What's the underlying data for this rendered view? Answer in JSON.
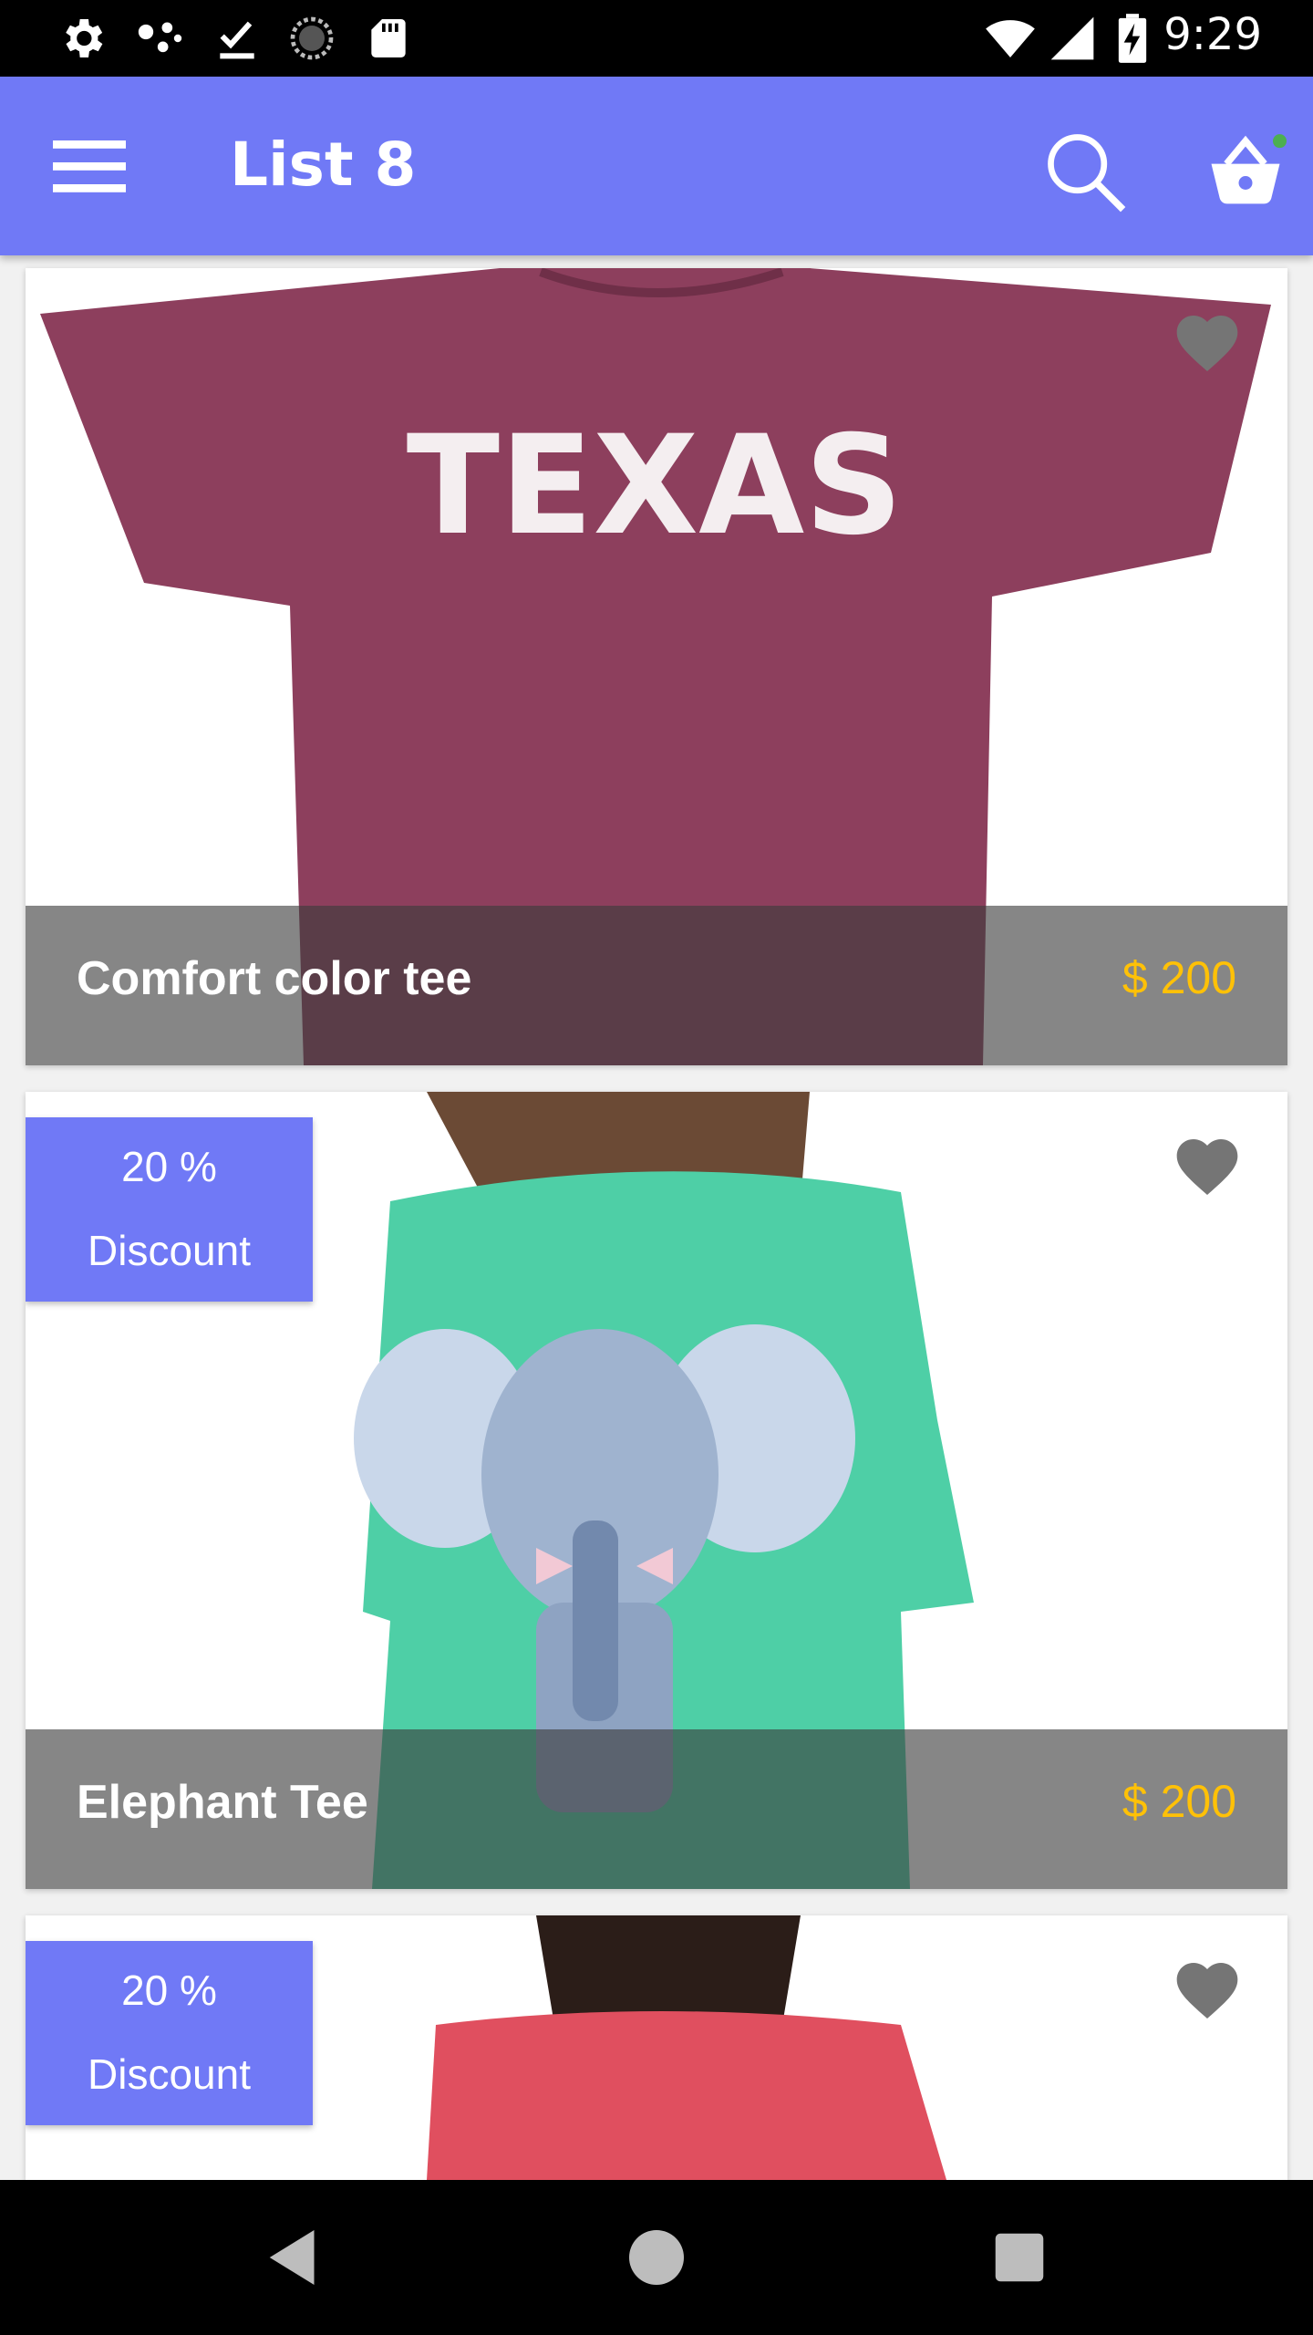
{
  "status_bar": {
    "time": "9:29",
    "left_icons": [
      "settings-icon",
      "dots-icon",
      "download-done-icon",
      "sync-icon",
      "sd-card-icon"
    ],
    "right_icons": [
      "wifi-icon",
      "signal-icon",
      "battery-charging-icon"
    ]
  },
  "app_bar": {
    "title": "List 8",
    "accent_color": "#7079f6"
  },
  "products": [
    {
      "name": "Comfort color tee",
      "price": "$ 200",
      "shirt_color": "#8d3f5d",
      "print_text": "TEXAS"
    },
    {
      "name": "Elephant Tee",
      "price": "$ 200",
      "shirt_color": "#4ecfa6",
      "discount_line1": "20 %",
      "discount_line2": "Discount"
    },
    {
      "shirt_color": "#e04f5f",
      "discount_line1": "20 %",
      "discount_line2": "Discount"
    }
  ],
  "colors": {
    "price": "#ffc107",
    "favorite_icon": "#757575"
  }
}
